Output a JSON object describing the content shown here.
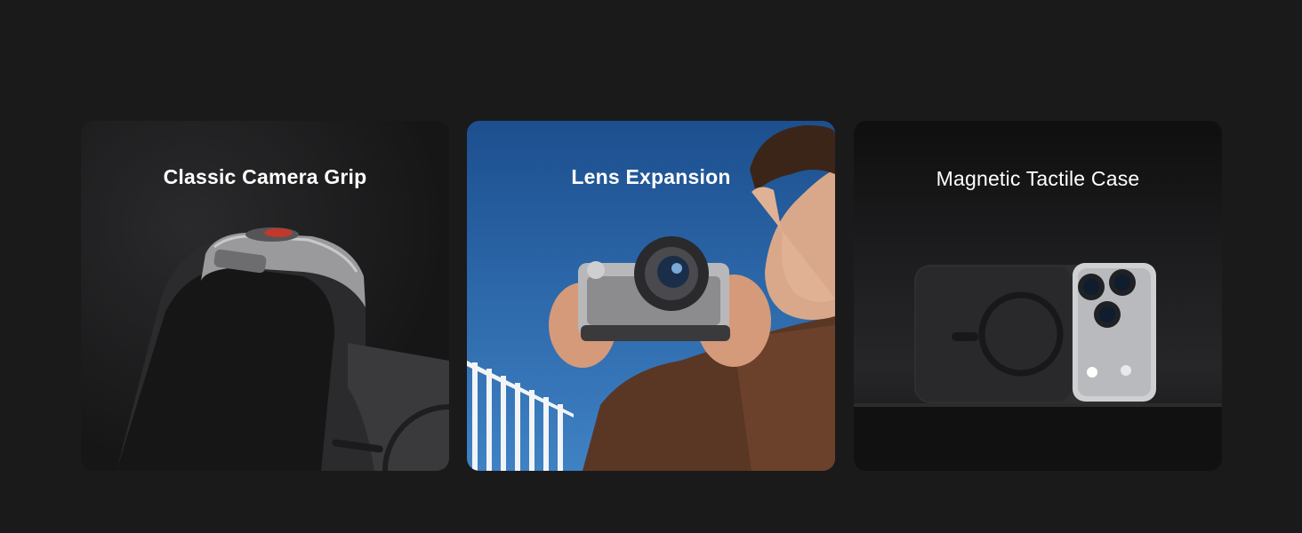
{
  "cards": [
    {
      "title": "Classic Camera Grip",
      "image": "camera-grip-product-photo"
    },
    {
      "title": "Lens Expansion",
      "image": "man-holding-phone-camera-photo"
    },
    {
      "title": "Magnetic Tactile Case",
      "image": "magnetic-phone-case-photo"
    }
  ],
  "colors": {
    "background": "#1a1a1b",
    "card_text": "#ffffff",
    "sky_blue": "#2b66a8"
  }
}
